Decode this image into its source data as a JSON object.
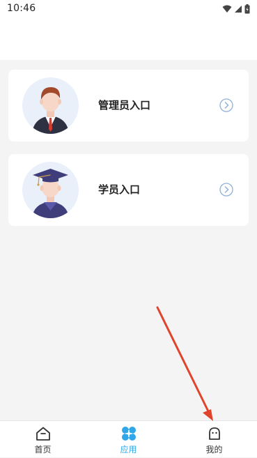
{
  "status_bar": {
    "time": "10:46"
  },
  "cards": [
    {
      "label": "管理员入口"
    },
    {
      "label": "学员入口"
    }
  ],
  "nav": {
    "items": [
      {
        "label": "首页",
        "icon": "home-icon"
      },
      {
        "label": "应用",
        "icon": "apps-icon",
        "active": true
      },
      {
        "label": "我的",
        "icon": "profile-icon"
      }
    ]
  },
  "colors": {
    "accent": "#2fa7e8",
    "annotation_arrow": "#e0442a"
  }
}
